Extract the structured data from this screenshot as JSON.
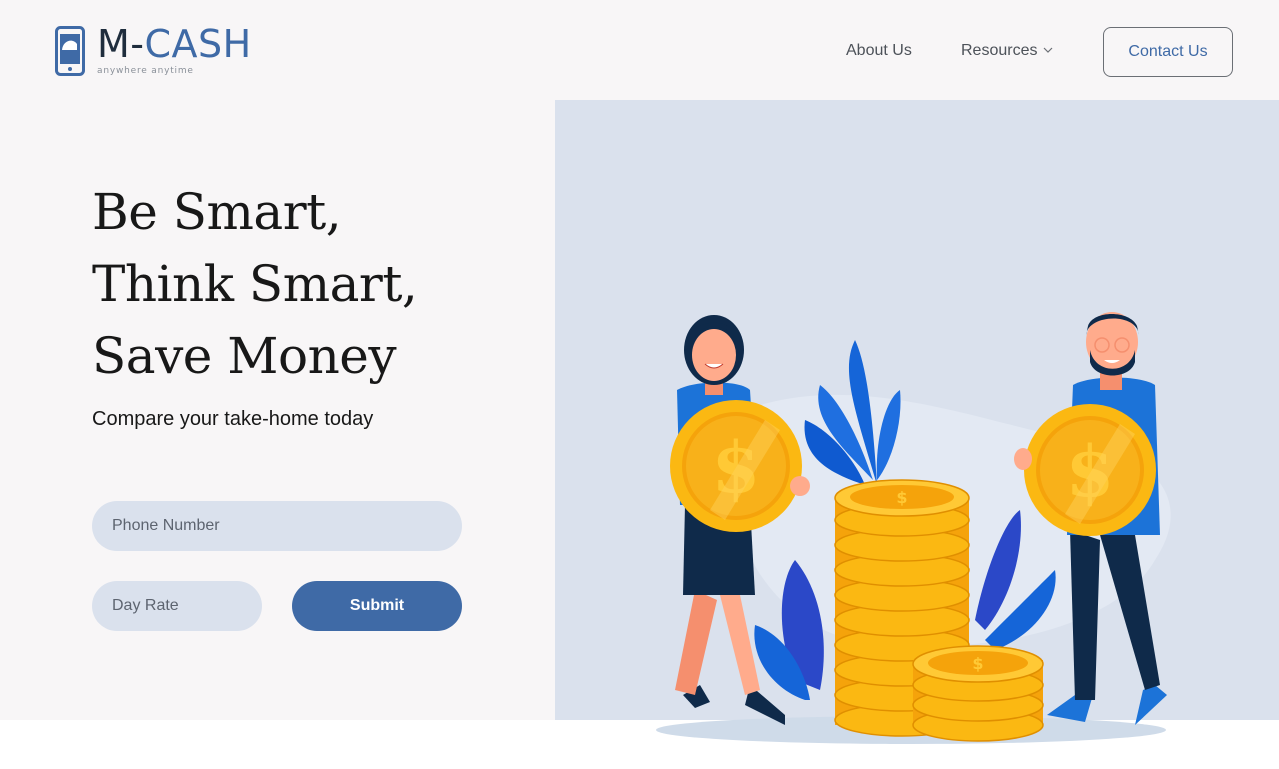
{
  "brand": {
    "name_prefix": "M-",
    "name_suffix": "CASH",
    "tagline": "anywhere anytime",
    "logo_icon": "mobile-phone-icon",
    "color": "#3f6aa6"
  },
  "nav": {
    "about": "About Us",
    "resources": "Resources",
    "resources_icon": "chevron-down-icon",
    "contact": "Contact Us"
  },
  "hero": {
    "line1": "Be Smart,",
    "line2": "Think Smart,",
    "line3": "Save Money",
    "subheadline": "Compare your take-home today"
  },
  "form": {
    "phone_placeholder": "Phone Number",
    "phone_value": "",
    "rate_placeholder": "Day Rate",
    "rate_value": "",
    "submit_label": "Submit"
  },
  "colors": {
    "accent": "#3f6aa6",
    "panel": "#dae1ed",
    "background": "#f8f6f7",
    "coin": "#fbb812"
  }
}
